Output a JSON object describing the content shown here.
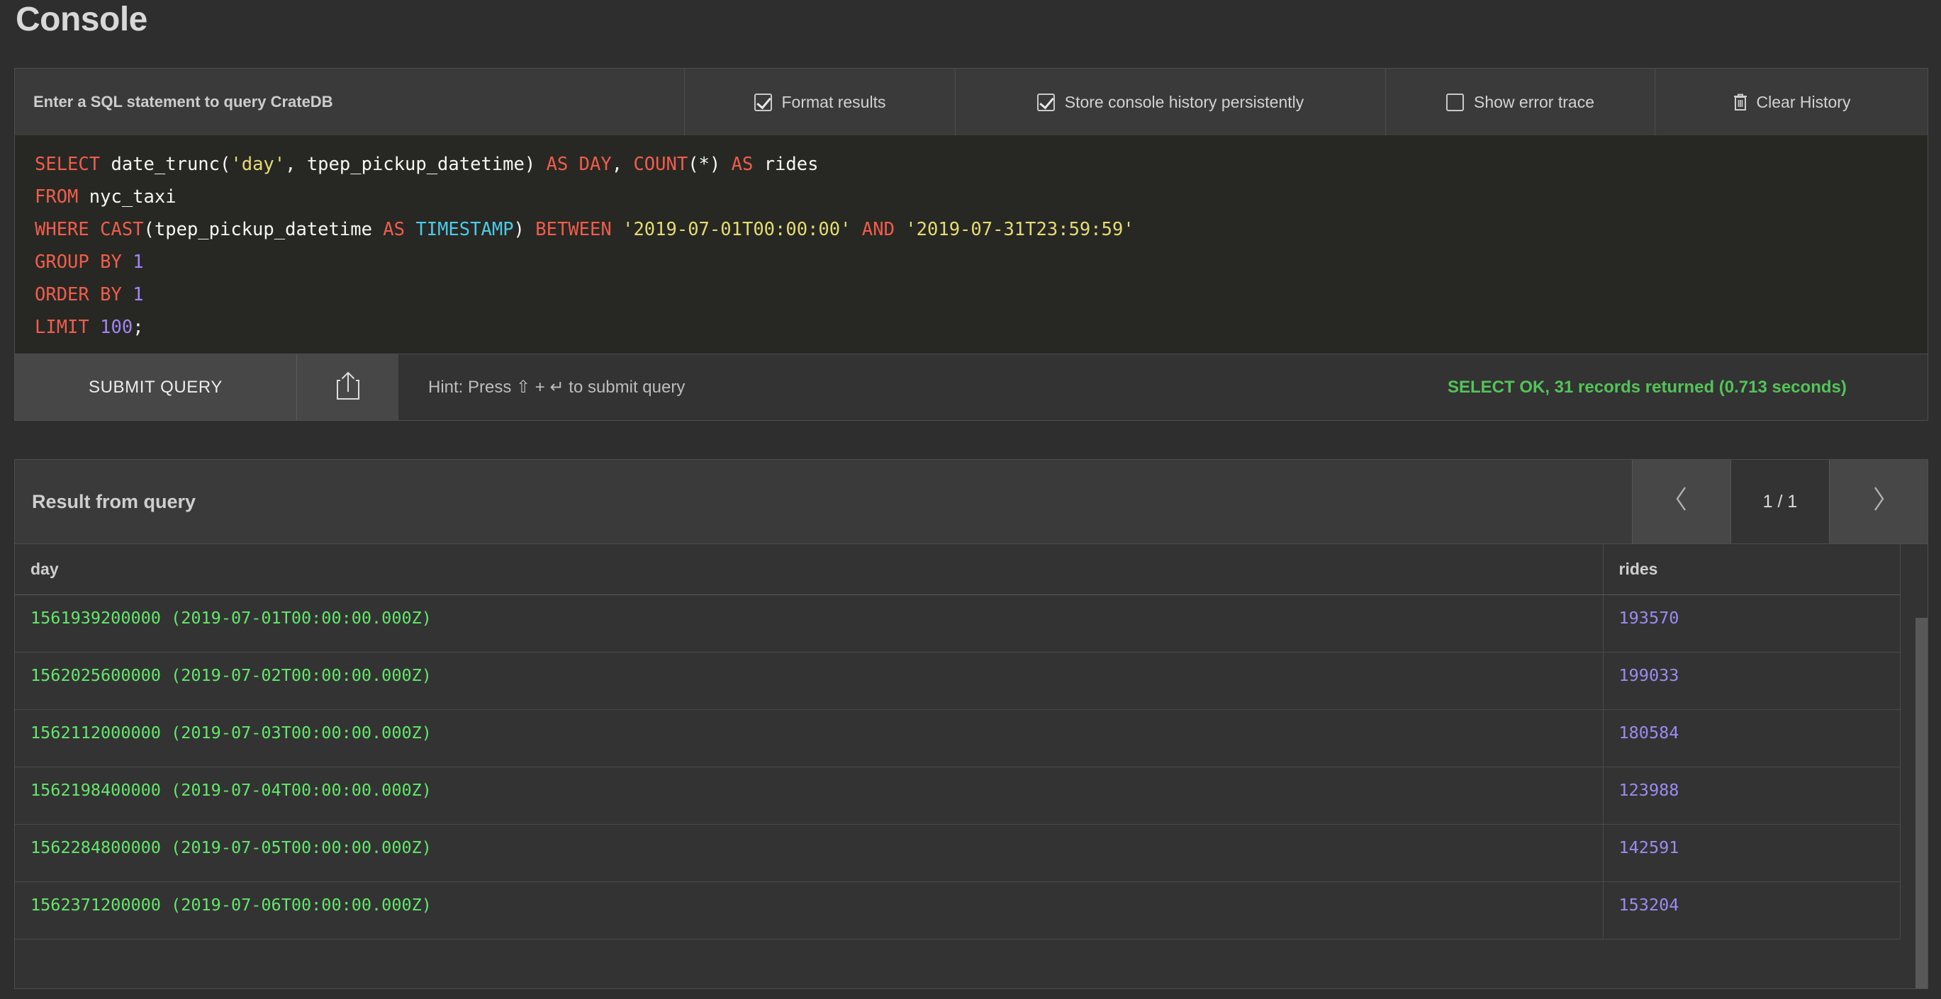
{
  "header": {
    "title": "Console"
  },
  "console": {
    "prompt_label": "Enter a SQL statement to query CrateDB",
    "options": [
      {
        "label": "Format results",
        "checked": true,
        "name": "format-results"
      },
      {
        "label": "Store console history persistently",
        "checked": true,
        "name": "store-history"
      },
      {
        "label": "Show error trace",
        "checked": false,
        "name": "show-error-trace"
      }
    ],
    "clear_history_label": "Clear History",
    "submit_label": "SUBMIT QUERY",
    "hint": "Hint: Press ⇧ + ↵ to submit query",
    "status": "SELECT OK, 31 records returned (0.713 seconds)",
    "status_color": "#53c458",
    "share_icon": "share-upload-icon",
    "trash_icon": "trash-icon",
    "sql_lines": [
      [
        {
          "t": "SELECT",
          "c": "kw"
        },
        {
          "t": " date_trunc(",
          "c": "pl"
        },
        {
          "t": "'day'",
          "c": "str"
        },
        {
          "t": ", tpep_pickup_datetime) ",
          "c": "pl"
        },
        {
          "t": "AS DAY",
          "c": "kw"
        },
        {
          "t": ", ",
          "c": "pl"
        },
        {
          "t": "COUNT",
          "c": "kw"
        },
        {
          "t": "(*) ",
          "c": "pl"
        },
        {
          "t": "AS",
          "c": "kw"
        },
        {
          "t": " rides",
          "c": "pl"
        }
      ],
      [
        {
          "t": "FROM",
          "c": "kw"
        },
        {
          "t": " nyc_taxi",
          "c": "pl"
        }
      ],
      [
        {
          "t": "WHERE CAST",
          "c": "kw"
        },
        {
          "t": "(tpep_pickup_datetime ",
          "c": "pl"
        },
        {
          "t": "AS",
          "c": "kw"
        },
        {
          "t": " ",
          "c": "pl"
        },
        {
          "t": "TIMESTAMP",
          "c": "typ"
        },
        {
          "t": ") ",
          "c": "pl"
        },
        {
          "t": "BETWEEN",
          "c": "kw"
        },
        {
          "t": " ",
          "c": "pl"
        },
        {
          "t": "'2019-07-01T00:00:00'",
          "c": "str"
        },
        {
          "t": " ",
          "c": "pl"
        },
        {
          "t": "AND",
          "c": "kw"
        },
        {
          "t": " ",
          "c": "pl"
        },
        {
          "t": "'2019-07-31T23:59:59'",
          "c": "str"
        }
      ],
      [
        {
          "t": "GROUP BY",
          "c": "kw"
        },
        {
          "t": " ",
          "c": "pl"
        },
        {
          "t": "1",
          "c": "num"
        }
      ],
      [
        {
          "t": "ORDER BY",
          "c": "kw"
        },
        {
          "t": " ",
          "c": "pl"
        },
        {
          "t": "1",
          "c": "num"
        }
      ],
      [
        {
          "t": "LIMIT",
          "c": "kw"
        },
        {
          "t": " ",
          "c": "pl"
        },
        {
          "t": "100",
          "c": "num"
        },
        {
          "t": ";",
          "c": "pl"
        }
      ]
    ]
  },
  "results": {
    "title": "Result from query",
    "prev_icon": "chevron-left-icon",
    "next_icon": "chevron-right-icon",
    "page_indicator": "1 / 1",
    "columns": [
      "day",
      "rides"
    ],
    "rows": [
      [
        "1561939200000 (2019-07-01T00:00:00.000Z)",
        "193570"
      ],
      [
        "1562025600000 (2019-07-02T00:00:00.000Z)",
        "199033"
      ],
      [
        "1562112000000 (2019-07-03T00:00:00.000Z)",
        "180584"
      ],
      [
        "1562198400000 (2019-07-04T00:00:00.000Z)",
        "123988"
      ],
      [
        "1562284800000 (2019-07-05T00:00:00.000Z)",
        "142591"
      ],
      [
        "1562371200000 (2019-07-06T00:00:00.000Z)",
        "153204"
      ]
    ],
    "day_color": "#63e86b",
    "rides_color": "#9b8cf0"
  }
}
